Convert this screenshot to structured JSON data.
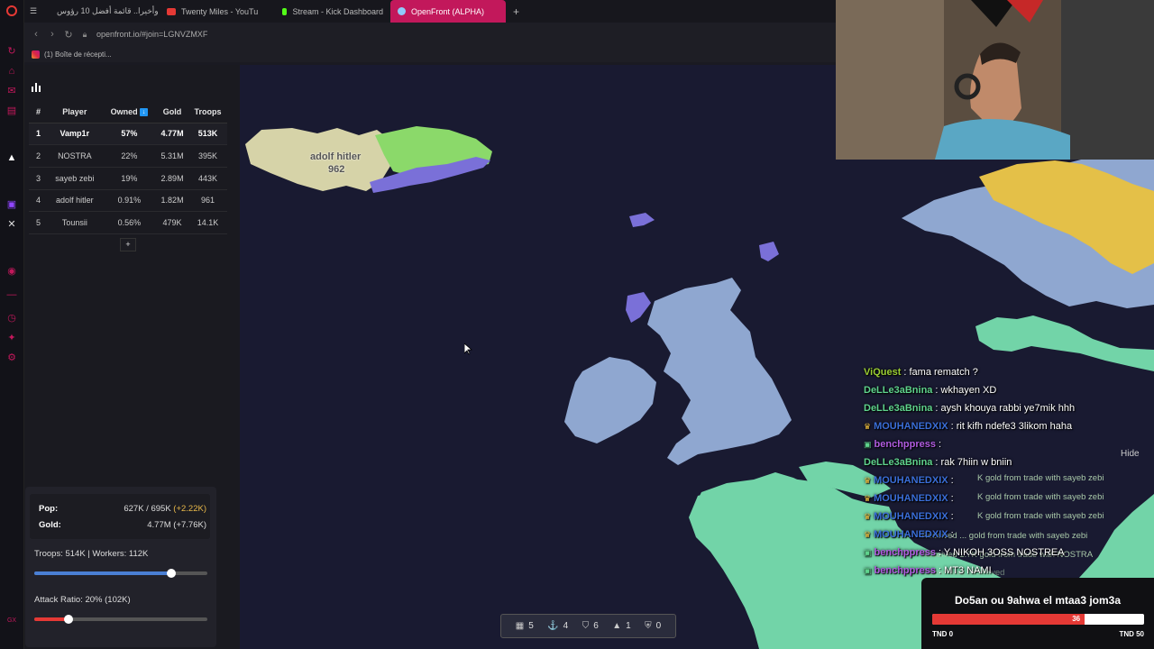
{
  "browser": {
    "tabs": [
      {
        "label": "وأخيرا.. قائمة أفضل 10 رؤوس",
        "color": "#e53935"
      },
      {
        "label": "Twenty Miles - YouTu",
        "color": "#e53935"
      },
      {
        "label": "Stream - Kick Dashboard",
        "color": "#53fc18"
      },
      {
        "label": "OpenFront (ALPHA)",
        "color": "#2196f3"
      }
    ],
    "new_tab": "+",
    "url": "openfront.io/#join=LGNVZMXF",
    "bookmark": "(1) Boîte de récepti..."
  },
  "leaderboard": {
    "headers": [
      "#",
      "Player",
      "Owned",
      "Gold",
      "Troops"
    ],
    "owned_icon": "↓",
    "rows": [
      {
        "rank": "1",
        "player": "Vamp1r",
        "owned": "57%",
        "gold": "4.77M",
        "troops": "513K"
      },
      {
        "rank": "2",
        "player": "NOSTRA",
        "owned": "22%",
        "gold": "5.31M",
        "troops": "395K"
      },
      {
        "rank": "3",
        "player": "sayeb zebi",
        "owned": "19%",
        "gold": "2.89M",
        "troops": "443K"
      },
      {
        "rank": "4",
        "player": "adolf hitler",
        "owned": "0.91%",
        "gold": "1.82M",
        "troops": "961"
      },
      {
        "rank": "5",
        "player": "Tounsii",
        "owned": "0.56%",
        "gold": "479K",
        "troops": "14.1K"
      }
    ],
    "expand_label": "+"
  },
  "stats": {
    "pop_label": "Pop:",
    "pop_value": "627K / 695K ",
    "pop_inc": "(+2.22K)",
    "gold_label": "Gold:",
    "gold_value": "4.77M (+7.76K)",
    "troops_workers": "Troops: 514K | Workers: 112K",
    "troops_ratio": 0.79,
    "attack_ratio_label": "Attack Ratio: 20% (102K)",
    "attack_ratio": 0.2,
    "colors": {
      "troops": "#4a7fd4",
      "attack": "#e53935"
    }
  },
  "map": {
    "player_label": "adolf hitler",
    "player_troops": "962",
    "bottom_bar": [
      {
        "icon": "city-icon",
        "glyph": "▦",
        "count": "5"
      },
      {
        "icon": "port-icon",
        "glyph": "⚓",
        "count": "4"
      },
      {
        "icon": "defense-icon",
        "glyph": "⛉",
        "count": "6"
      },
      {
        "icon": "missile-icon",
        "glyph": "▲",
        "count": "1"
      },
      {
        "icon": "sam-icon",
        "glyph": "⛨",
        "count": "0"
      }
    ],
    "hide_label": "Hide",
    "faded_events": [
      "K gold from trade with sayeb zebi",
      "K gold from trade with sayeb zebi",
      "K gold from trade with sayeb zebi",
      "Received ... gold from trade with sayeb zebi",
      "Received 1.7K gold from trade with NOSTRA",
      "...ation was destroyed"
    ]
  },
  "chat": [
    {
      "user": "ViQuest",
      "color": "#9acd32",
      "badge": "",
      "text": ": fama rematch ?"
    },
    {
      "user": "DeLLe3aBnina",
      "color": "#5fd38d",
      "badge": "",
      "text": ": wkhayen XD"
    },
    {
      "user": "DeLLe3aBnina",
      "color": "#5fd38d",
      "badge": "",
      "text": ": aysh khouya rabbi ye7mik hhh"
    },
    {
      "user": "MOUHANEDXIX",
      "color": "#3a6ed8",
      "badge": "♛",
      "text": ": rit kifh ndefe3 3likom haha"
    },
    {
      "user": "benchppress",
      "color": "#b05ce0",
      "badge": "▣",
      "text": ": "
    },
    {
      "user": "DeLLe3aBnina",
      "color": "#5fd38d",
      "badge": "",
      "text": ": rak 7hiin w bniin"
    },
    {
      "user": "MOUHANEDXIX",
      "color": "#3a6ed8",
      "badge": "♛",
      "text": ": "
    },
    {
      "user": "MOUHANEDXIX",
      "color": "#3a6ed8",
      "badge": "♛",
      "text": ": "
    },
    {
      "user": "MOUHANEDXIX",
      "color": "#3a6ed8",
      "badge": "♛",
      "text": ": "
    },
    {
      "user": "MOUHANEDXIX",
      "color": "#3a6ed8",
      "badge": "♛",
      "text": ": "
    },
    {
      "user": "benchppress",
      "color": "#b05ce0",
      "badge": "▣",
      "text": ": Y NIKOH 3OSS NOSTREA"
    },
    {
      "user": "benchppress",
      "color": "#b05ce0",
      "badge": "▣",
      "text": ": MT3 NAMI"
    }
  ],
  "poll": {
    "question": "Do5an ou 9ahwa el mtaa3 jom3a",
    "count": "36",
    "fill": 0.72,
    "left_option": "TND 0",
    "right_option": "TND 50"
  }
}
